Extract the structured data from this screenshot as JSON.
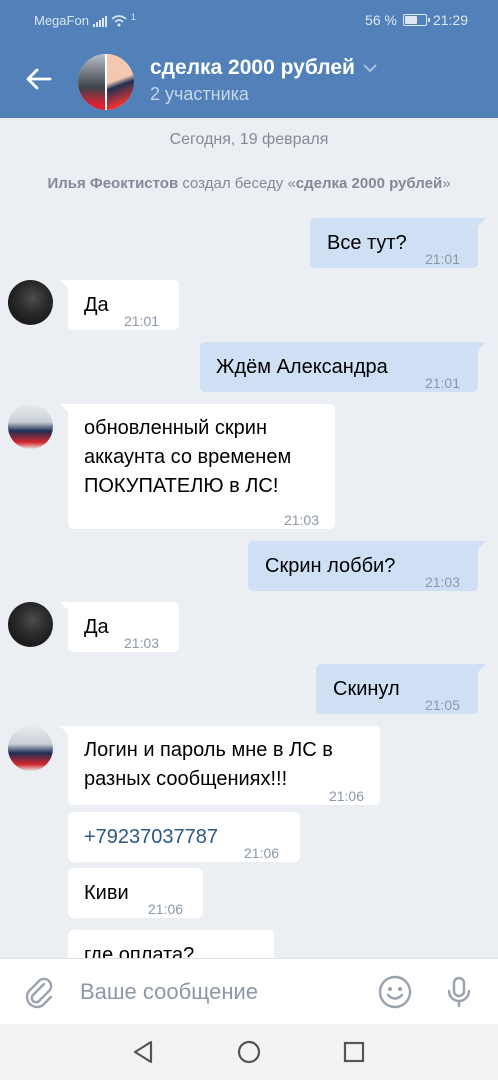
{
  "status_bar": {
    "carrier": "MegaFon",
    "battery_percent": "56 %",
    "battery_level": 0.56,
    "time": "21:29",
    "notification_count": "1"
  },
  "header": {
    "title": "сделка 2000 рублей",
    "subtitle": "2 участника",
    "icons": [
      "back-arrow-icon",
      "chevron-down-icon"
    ],
    "color": "#5181b8"
  },
  "chat": {
    "date_divider": "Сегодня, 19 февраля",
    "system_event": {
      "author": "Илья Феоктистов",
      "action": "создал беседу «",
      "chat_name": "сделка 2000 рублей",
      "close": "»"
    },
    "messages": [
      {
        "dir": "out",
        "text": "Все тут?",
        "time": "21:01"
      },
      {
        "dir": "in",
        "text": "Да",
        "time": "21:01"
      },
      {
        "dir": "out",
        "text": "Ждём Александра",
        "time": "21:01"
      },
      {
        "dir": "in",
        "lines": [
          "обновленный скрин",
          "аккаунта со временем",
          "ПОКУПАТЕЛЮ в ЛС!"
        ],
        "time": "21:03"
      },
      {
        "dir": "out",
        "text": "Скрин лобби?",
        "time": "21:03"
      },
      {
        "dir": "in",
        "text": "Да",
        "time": "21:03"
      },
      {
        "dir": "out",
        "text": "Скинул",
        "time": "21:05"
      },
      {
        "dir": "in",
        "lines": [
          "Логин и пароль мне в ЛС в",
          "разных сообщениях!!!"
        ],
        "time": "21:06"
      },
      {
        "dir": "in",
        "text": "+79237037787",
        "time": "21:06"
      },
      {
        "dir": "in",
        "text": "Киви",
        "time": "21:06"
      },
      {
        "dir": "in",
        "text": "где оплата?"
      }
    ]
  },
  "composer": {
    "placeholder": "Ваше сообщение",
    "icons": [
      "paperclip-icon",
      "emoji-icon",
      "microphone-icon"
    ]
  },
  "navigation": {
    "icons": [
      "nav-back-icon",
      "nav-home-icon",
      "nav-recents-icon"
    ]
  }
}
